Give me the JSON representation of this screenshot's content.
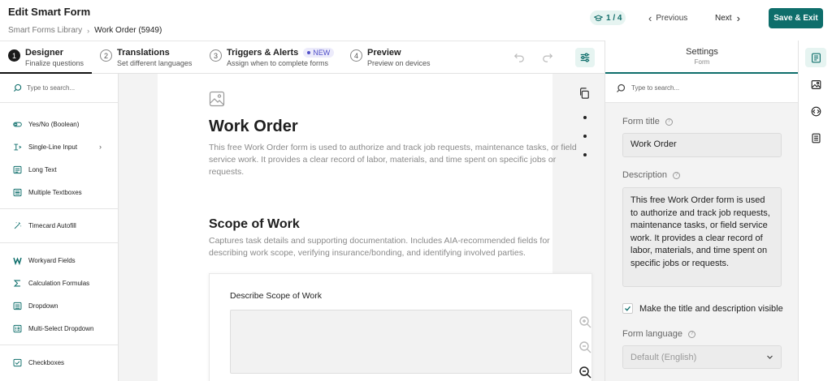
{
  "header": {
    "title": "Edit Smart Form",
    "breadcrumb": {
      "root": "Smart Forms Library",
      "current": "Work Order (5949)"
    },
    "progress": "1 / 4",
    "previous_label": "Previous",
    "next_label": "Next",
    "save_label": "Save & Exit"
  },
  "steps": [
    {
      "num": "1",
      "title": "Designer",
      "subtitle": "Finalize questions"
    },
    {
      "num": "2",
      "title": "Translations",
      "subtitle": "Set different languages"
    },
    {
      "num": "3",
      "title": "Triggers & Alerts",
      "subtitle": "Assign when to complete forms",
      "badge": "NEW"
    },
    {
      "num": "4",
      "title": "Preview",
      "subtitle": "Preview on devices"
    }
  ],
  "palette": {
    "search_placeholder": "Type to search...",
    "items": [
      {
        "label": "Yes/No (Boolean)",
        "icon": "toggle-icon"
      },
      {
        "label": "Single-Line Input",
        "icon": "single-line-icon"
      },
      {
        "label": "Long Text",
        "icon": "long-text-icon"
      },
      {
        "label": "Multiple Textboxes",
        "icon": "multiple-textboxes-icon"
      },
      {
        "label": "Timecard Autofill",
        "icon": "magic-wand-icon"
      },
      {
        "label": "Workyard Fields",
        "icon": "workyard-logo-icon"
      },
      {
        "label": "Calculation Formulas",
        "icon": "sigma-icon"
      },
      {
        "label": "Dropdown",
        "icon": "dropdown-icon"
      },
      {
        "label": "Multi-Select Dropdown",
        "icon": "multi-select-icon"
      },
      {
        "label": "Checkboxes",
        "icon": "checkbox-icon"
      }
    ]
  },
  "canvas": {
    "form_title": "Work Order",
    "form_description": "This free Work Order form is used to authorize and track job requests, maintenance tasks, or field service work. It provides a clear record of labor, materials, and time spent on specific jobs or requests.",
    "section_title": "Scope of Work",
    "section_description": "Captures task details and supporting documentation. Includes AIA-recommended fields for describing work scope, verifying insurance/bonding, and identifying involved parties.",
    "question_label": "Describe Scope of Work"
  },
  "settings": {
    "title": "Settings",
    "subtitle": "Form",
    "search_placeholder": "Type to search...",
    "form_title_label": "Form title",
    "form_title_value": "Work Order",
    "description_label": "Description",
    "description_value": "This free Work Order form is used to authorize and track job requests, maintenance tasks, or field service work. It provides a clear record of labor, materials, and time spent on specific jobs or requests.",
    "visible_checkbox_label": "Make the title and description visible",
    "visible_checked": true,
    "language_label": "Form language",
    "language_value": "Default (English)"
  },
  "colors": {
    "accent": "#0e6e6b",
    "accent_light": "#e6f4f1",
    "new_badge": "#5150c8"
  }
}
